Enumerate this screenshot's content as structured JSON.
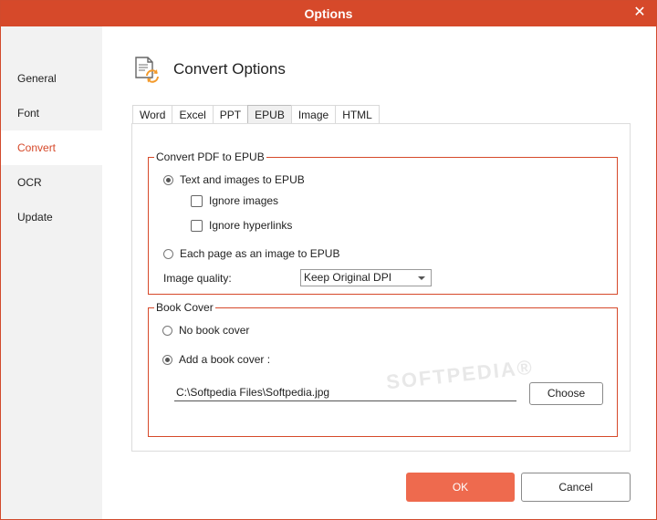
{
  "window": {
    "title": "Options"
  },
  "sidebar": {
    "items": [
      {
        "label": "General"
      },
      {
        "label": "Font"
      },
      {
        "label": "Convert"
      },
      {
        "label": "OCR"
      },
      {
        "label": "Update"
      }
    ],
    "active": "Convert"
  },
  "header": {
    "title": "Convert Options",
    "icon": "convert-document-icon"
  },
  "tabs": {
    "items": [
      {
        "label": "Word"
      },
      {
        "label": "Excel"
      },
      {
        "label": "PPT"
      },
      {
        "label": "EPUB"
      },
      {
        "label": "Image"
      },
      {
        "label": "HTML"
      }
    ],
    "active": "EPUB"
  },
  "convert_group": {
    "label": "Convert PDF to EPUB",
    "text_images_label": "Text and images to EPUB",
    "ignore_images_label": "Ignore images",
    "ignore_hyperlinks_label": "Ignore hyperlinks",
    "each_page_label": "Each page as an image to EPUB",
    "image_quality_label": "Image quality:",
    "image_quality_value": "Keep Original DPI",
    "selected": "text_images",
    "ignore_images_checked": false,
    "ignore_hyperlinks_checked": false
  },
  "cover_group": {
    "label": "Book Cover",
    "no_cover_label": "No book cover",
    "add_cover_label": "Add a book cover :",
    "cover_path": "C:\\Softpedia Files\\Softpedia.jpg",
    "choose_label": "Choose",
    "selected": "add_cover"
  },
  "footer": {
    "ok_label": "OK",
    "cancel_label": "Cancel"
  },
  "colors": {
    "accent": "#d6492a",
    "ok_button": "#ee6a4e",
    "sidebar_bg": "#f2f2f2"
  }
}
